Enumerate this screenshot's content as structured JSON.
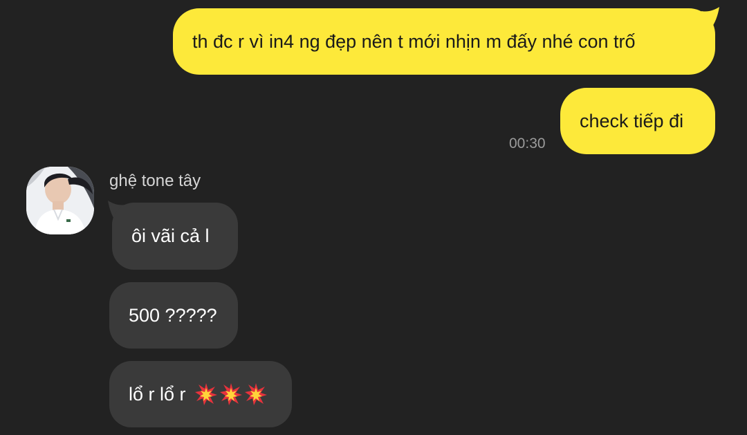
{
  "messages": {
    "outgoing": [
      {
        "text": "th đc r vì in4 ng đẹp nên t mới nhịn m đấy nhé con trố"
      },
      {
        "text": "check tiếp đi",
        "time": "00:30"
      }
    ],
    "incoming": {
      "sender_name": "ghệ tone tây",
      "items": [
        {
          "text": "ôi vãi cả l"
        },
        {
          "text": "500 ?????"
        },
        {
          "text": "lổ r lổ r",
          "emoji": [
            "collision-emoji",
            "collision-emoji",
            "collision-emoji"
          ]
        }
      ]
    }
  },
  "colors": {
    "background": "#222222",
    "outgoing_bubble": "#fde93a",
    "incoming_bubble": "#3a3a3a"
  }
}
